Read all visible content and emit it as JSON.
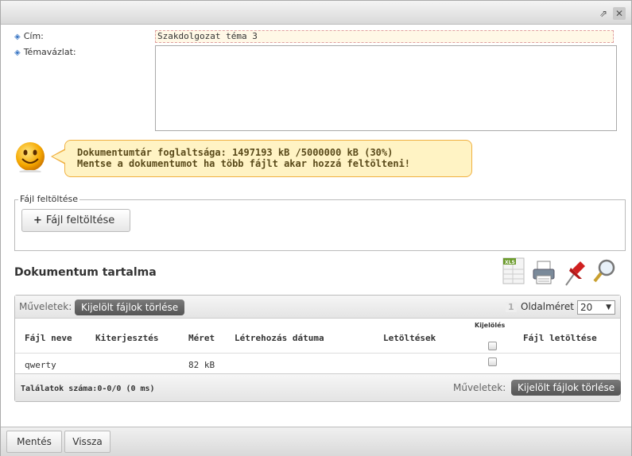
{
  "titlebar": {
    "restore_icon": "external-window-icon",
    "close_icon": "close-icon"
  },
  "form": {
    "title_label": "Cím:",
    "title_value": "Szakdolgozat téma 3",
    "outline_label": "Témavázlat:",
    "outline_value": ""
  },
  "notice": {
    "line1": "Dokumentumtár foglaltsága: 1497193 kB /5000000 kB (30%)",
    "line2": "Mentse a dokumentumot ha több fájlt akar hozzá feltölteni!"
  },
  "upload": {
    "legend": "Fájl feltöltése",
    "button_label": "Fájl feltöltése"
  },
  "documents": {
    "title": "Dokumentum tartalma",
    "tools": [
      "xls-export-icon",
      "print-icon",
      "pin-icon",
      "search-icon"
    ],
    "ops_label": "Műveletek:",
    "delete_selected": "Kijelölt fájlok törlése",
    "page_number": "1",
    "page_size_label": "Oldalméret",
    "page_size_value": "20",
    "columns": {
      "name": "Fájl neve",
      "ext": "Kiterjesztés",
      "size": "Méret",
      "created": "Létrehozás dátuma",
      "downloads": "Letöltések",
      "select": "Kijelölés",
      "download_file": "Fájl letöltése"
    },
    "rows": [
      {
        "name": "qwerty",
        "ext": "",
        "size": "82 kB",
        "created": "",
        "downloads": ""
      }
    ],
    "results": "Találatok száma:0-0/0 (0 ms)",
    "ops_label_bottom": "Műveletek:",
    "delete_selected_bottom": "Kijelölt fájlok törlése"
  },
  "footer": {
    "save": "Mentés",
    "back": "Vissza"
  }
}
